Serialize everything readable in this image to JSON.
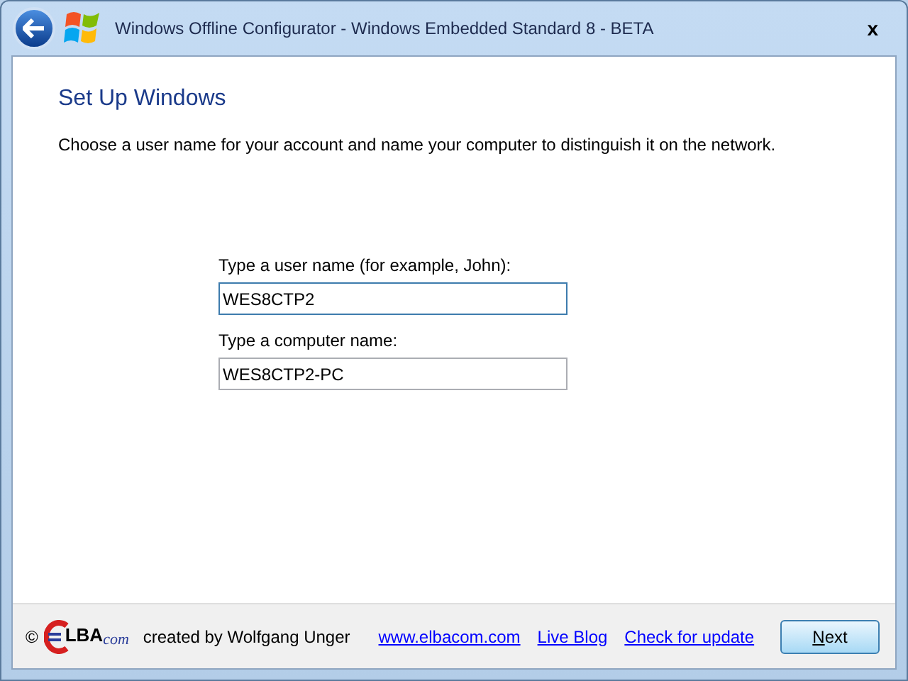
{
  "window": {
    "title": "Windows Offline Configurator - Windows Embedded Standard 8 - BETA",
    "close": "x"
  },
  "page": {
    "heading": "Set Up Windows",
    "description": "Choose a user name for your account and name your computer to distinguish it on the network."
  },
  "fields": [
    {
      "label": "Type a user name (for example, John):",
      "value": "WES8CTP2",
      "focused": true
    },
    {
      "label": "Type a computer name:",
      "value": "WES8CTP2-PC",
      "focused": false
    }
  ],
  "footer": {
    "copyright": "©",
    "logo": {
      "main": "LBA",
      "suffix": "com"
    },
    "credit": "created by Wolfgang Unger",
    "links": [
      "www.elbacom.com",
      "Live Blog",
      "Check for update"
    ],
    "button": "Next"
  }
}
